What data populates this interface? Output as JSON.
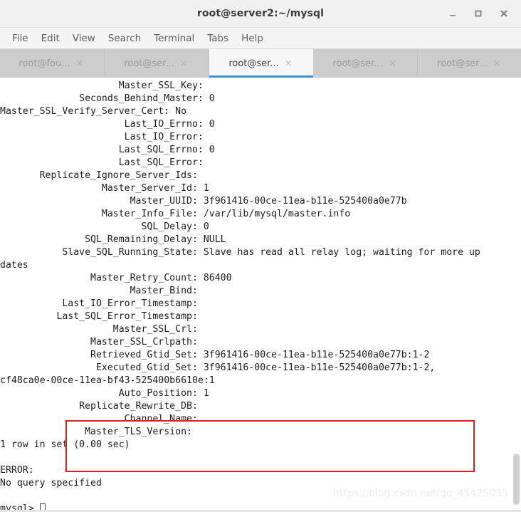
{
  "window": {
    "title": "root@server2:~/mysql",
    "buttons": [
      {
        "name": "minimize",
        "glyph": "minimize-icon"
      },
      {
        "name": "maximize",
        "glyph": "maximize-icon"
      },
      {
        "name": "close",
        "glyph": "close-icon"
      }
    ]
  },
  "menubar": {
    "items": [
      "File",
      "Edit",
      "View",
      "Search",
      "Terminal",
      "Tabs",
      "Help"
    ]
  },
  "tabs": [
    {
      "label": "root@fou...",
      "close": "×",
      "active": false
    },
    {
      "label": "root@ser...",
      "close": "×",
      "active": false
    },
    {
      "label": "root@ser...",
      "close": "×",
      "active": true
    },
    {
      "label": "root@ser...",
      "close": "×",
      "active": false
    },
    {
      "label": "root@ser...",
      "close": "×",
      "active": false
    }
  ],
  "terminal": {
    "lines": [
      "                     Master_SSL_Key: ",
      "              Seconds_Behind_Master: 0",
      "Master_SSL_Verify_Server_Cert: No",
      "                      Last_IO_Errno: 0",
      "                      Last_IO_Error: ",
      "                     Last_SQL_Errno: 0",
      "                     Last_SQL_Error: ",
      "       Replicate_Ignore_Server_Ids: ",
      "                  Master_Server_Id: 1",
      "                       Master_UUID: 3f961416-00ce-11ea-b11e-525400a0e77b",
      "                  Master_Info_File: /var/lib/mysql/master.info",
      "                         SQL_Delay: 0",
      "               SQL_Remaining_Delay: NULL",
      "           Slave_SQL_Running_State: Slave has read all relay log; waiting for more up",
      "dates",
      "                Master_Retry_Count: 86400",
      "                       Master_Bind: ",
      "           Last_IO_Error_Timestamp: ",
      "          Last_SQL_Error_Timestamp: ",
      "                    Master_SSL_Crl: ",
      "                Master_SSL_Crlpath: ",
      "                Retrieved_Gtid_Set: 3f961416-00ce-11ea-b11e-525400a0e77b:1-2",
      "                 Executed_Gtid_Set: 3f961416-00ce-11ea-b11e-525400a0e77b:1-2,",
      "cf48ca0e-00ce-11ea-bf43-525400b6610e:1",
      "                     Auto_Position: 1",
      "              Replicate_Rewrite_DB: ",
      "                      Channel_Name: ",
      "               Master_TLS_Version: ",
      "1 row in set (0.00 sec)",
      "",
      "ERROR: ",
      "No query specified",
      "",
      "mysql> "
    ],
    "prompt_cursor": true
  },
  "annotation": {
    "kind": "red-rectangle-highlight",
    "color": "#e21b1b",
    "covers": [
      "Retrieved_Gtid_Set: 3f961416-00ce-11ea-b11e-525400a0e77b:1-2",
      "Executed_Gtid_Set: 3f961416-00ce-11ea-b11e-525400a0e77b:1-2,",
      "cf48ca0e-00ce-11ea-bf43-525400b6610e:1",
      "Auto_Position: 1"
    ]
  },
  "watermark": {
    "text": "https://blog.csdn.net/qq_45425035"
  },
  "theme": {
    "accent": "#3a92e0",
    "titlebar_bg": "#f0f0f0",
    "tabbar_bg": "#cccccc",
    "terminal_bg": "#ffffff",
    "terminal_fg": "#1c1c1c"
  }
}
